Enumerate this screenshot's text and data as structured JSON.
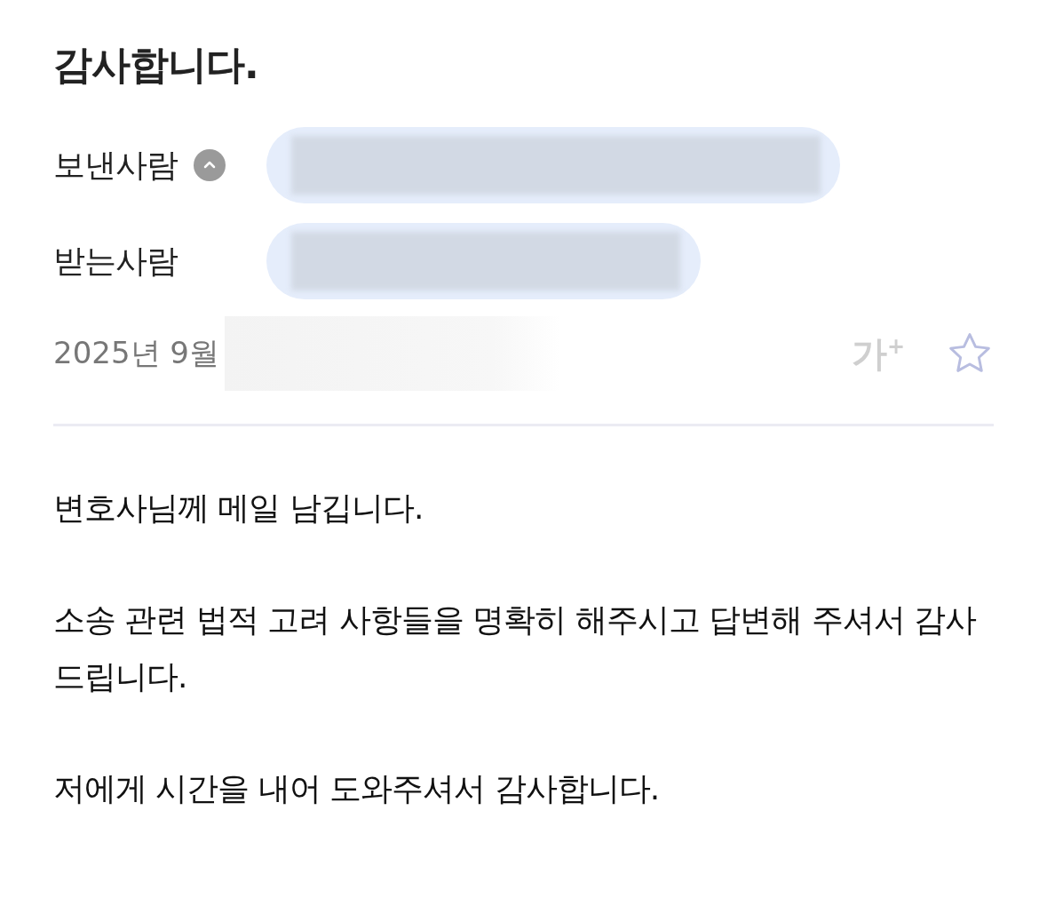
{
  "subject": "감사합니다.",
  "sender": {
    "label": "보낸사람",
    "expanded": true
  },
  "recipient": {
    "label": "받는사람"
  },
  "date": "2025년 9월",
  "font_size_button": "가$^{+}$",
  "starred": false,
  "body": [
    "변호사님께 메일 남깁니다.",
    "소송 관련 법적 고려 사항들을 명확히 해주시고 답변해 주셔서 감사드립니다.",
    "저에게 시간을 내어 도와주셔서 감사합니다."
  ]
}
